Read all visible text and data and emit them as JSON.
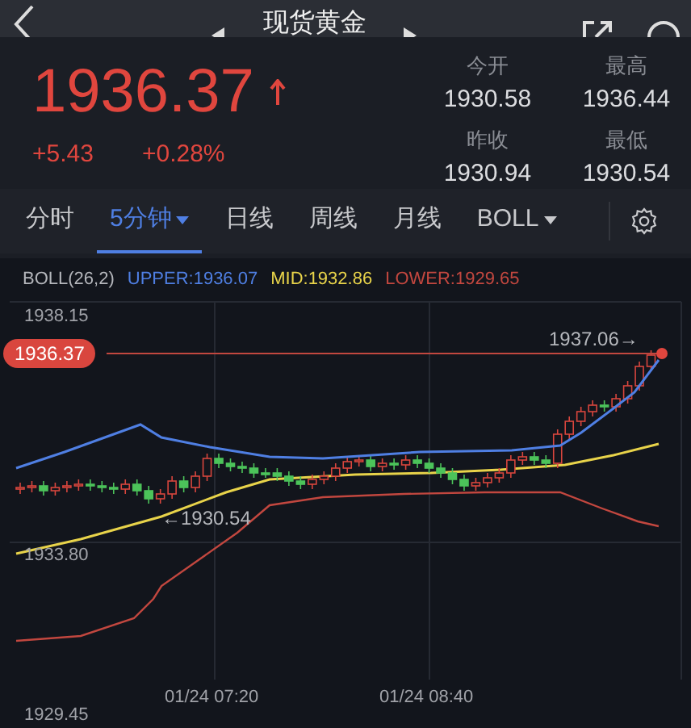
{
  "nav": {
    "title": "现货黄金"
  },
  "quote": {
    "price": "1936.37",
    "change": "+5.43",
    "change_pct": "+0.28%"
  },
  "stats": [
    {
      "label": "今开",
      "value": "1930.58"
    },
    {
      "label": "最高",
      "value": "1936.44"
    },
    {
      "label": "昨收",
      "value": "1930.94"
    },
    {
      "label": "最低",
      "value": "1930.54"
    }
  ],
  "tabs": [
    {
      "label": "分时",
      "selected": false,
      "dropdown": false
    },
    {
      "label": "5分钟",
      "selected": true,
      "dropdown": true
    },
    {
      "label": "日线",
      "selected": false,
      "dropdown": false
    },
    {
      "label": "周线",
      "selected": false,
      "dropdown": false
    },
    {
      "label": "月线",
      "selected": false,
      "dropdown": false
    },
    {
      "label": "BOLL",
      "selected": false,
      "dropdown": true
    }
  ],
  "indicator": {
    "name": "BOLL(26,2)",
    "upper": "UPPER:1936.07",
    "mid": "MID:1932.86",
    "lower": "LOWER:1929.65"
  },
  "chart": {
    "y_labels": [
      "1938.15",
      "1933.80",
      "1929.45"
    ],
    "x_labels": [
      "01/24 07:20",
      "01/24 08:40"
    ],
    "price_tag": "1936.37",
    "high_marker": "1937.06→",
    "low_marker": "←1930.54"
  }
}
